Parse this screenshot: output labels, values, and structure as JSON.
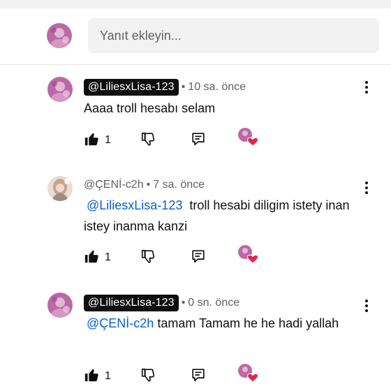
{
  "reply_box": {
    "placeholder": "Yanıt ekleyin..."
  },
  "comments": [
    {
      "author": "@LiliesxLisa-123",
      "author_style": "chip",
      "separator": "•",
      "time": "10 sa. önce",
      "mention": "",
      "text": "Aaaa troll hesabı selam",
      "likes": "1"
    },
    {
      "author": "@ÇENİ-c2h",
      "author_style": "plain",
      "separator": "•",
      "time": "7 sa. önce",
      "mention": "@LiliesxLisa-123",
      "text": "troll hesabi diligim istety inan istey inanma kanzi",
      "likes": "1"
    },
    {
      "author": "@LiliesxLisa-123",
      "author_style": "chip",
      "separator": "•",
      "time": "0 sn. önce",
      "mention": "@ÇENİ-c2h",
      "text": "tamam Tamam he he hadi yallah",
      "likes": "1"
    }
  ],
  "icons": {
    "like": "thumbs-up-filled-icon",
    "dislike": "thumbs-down-icon",
    "reply": "reply-comment-icon",
    "heart": "creator-heart-icon",
    "more": "more-vertical-icon"
  },
  "colors": {
    "mention": "#065fd4",
    "heart": "#e4254a",
    "chip_bg": "#0f0f0f",
    "secondary_text": "#606060",
    "input_bg": "#f2f2f2"
  }
}
